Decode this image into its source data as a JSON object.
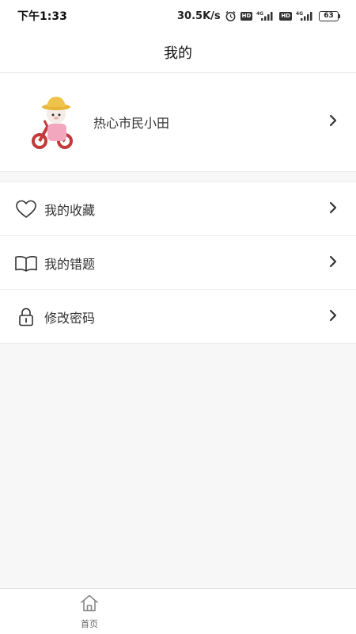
{
  "status_bar": {
    "time": "下午1:33",
    "speed": "30.5K/s",
    "battery": "63",
    "icons": [
      "alarm-icon",
      "hd-badge",
      "signal-4g-icon",
      "hd-badge",
      "signal-4g-icon",
      "battery-icon"
    ],
    "hd_label": "HD",
    "net_label": "4G"
  },
  "header": {
    "title": "我的"
  },
  "profile": {
    "name": "热心市民小田"
  },
  "menu": {
    "items": [
      {
        "label": "我的收藏",
        "icon": "heart-icon"
      },
      {
        "label": "我的错题",
        "icon": "book-icon"
      },
      {
        "label": "修改密码",
        "icon": "lock-icon"
      }
    ]
  },
  "tabbar": {
    "home_label": "首页",
    "home_icon": "home-icon"
  },
  "colors": {
    "background": "#f7f7f7",
    "surface": "#ffffff",
    "divider": "#ececec",
    "text": "#333333"
  }
}
